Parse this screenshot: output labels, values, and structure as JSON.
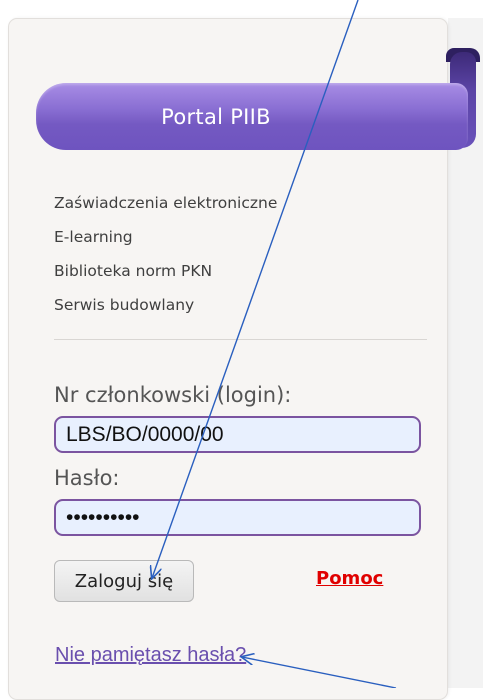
{
  "header": {
    "title": "Portal PIIB"
  },
  "links": [
    {
      "label": "Zaświadczenia elektroniczne"
    },
    {
      "label": "E-learning"
    },
    {
      "label": "Biblioteka norm PKN"
    },
    {
      "label": "Serwis budowlany"
    }
  ],
  "login": {
    "login_label": "Nr członkowski (login):",
    "login_value": "LBS/BO/0000/00",
    "password_label": "Hasło:",
    "password_value": "••••••••••",
    "submit_label": "Zaloguj się",
    "help_label": "Pomoc",
    "forgot_label": "Nie pamiętasz hasła?"
  },
  "colors": {
    "ribbon": "#7a5fcb",
    "field_border": "#7b54a0",
    "field_bg": "#e8f0fe",
    "help": "#e00000",
    "forgot": "#6a4fae",
    "annotation_arrow": "#2a5fbf"
  }
}
